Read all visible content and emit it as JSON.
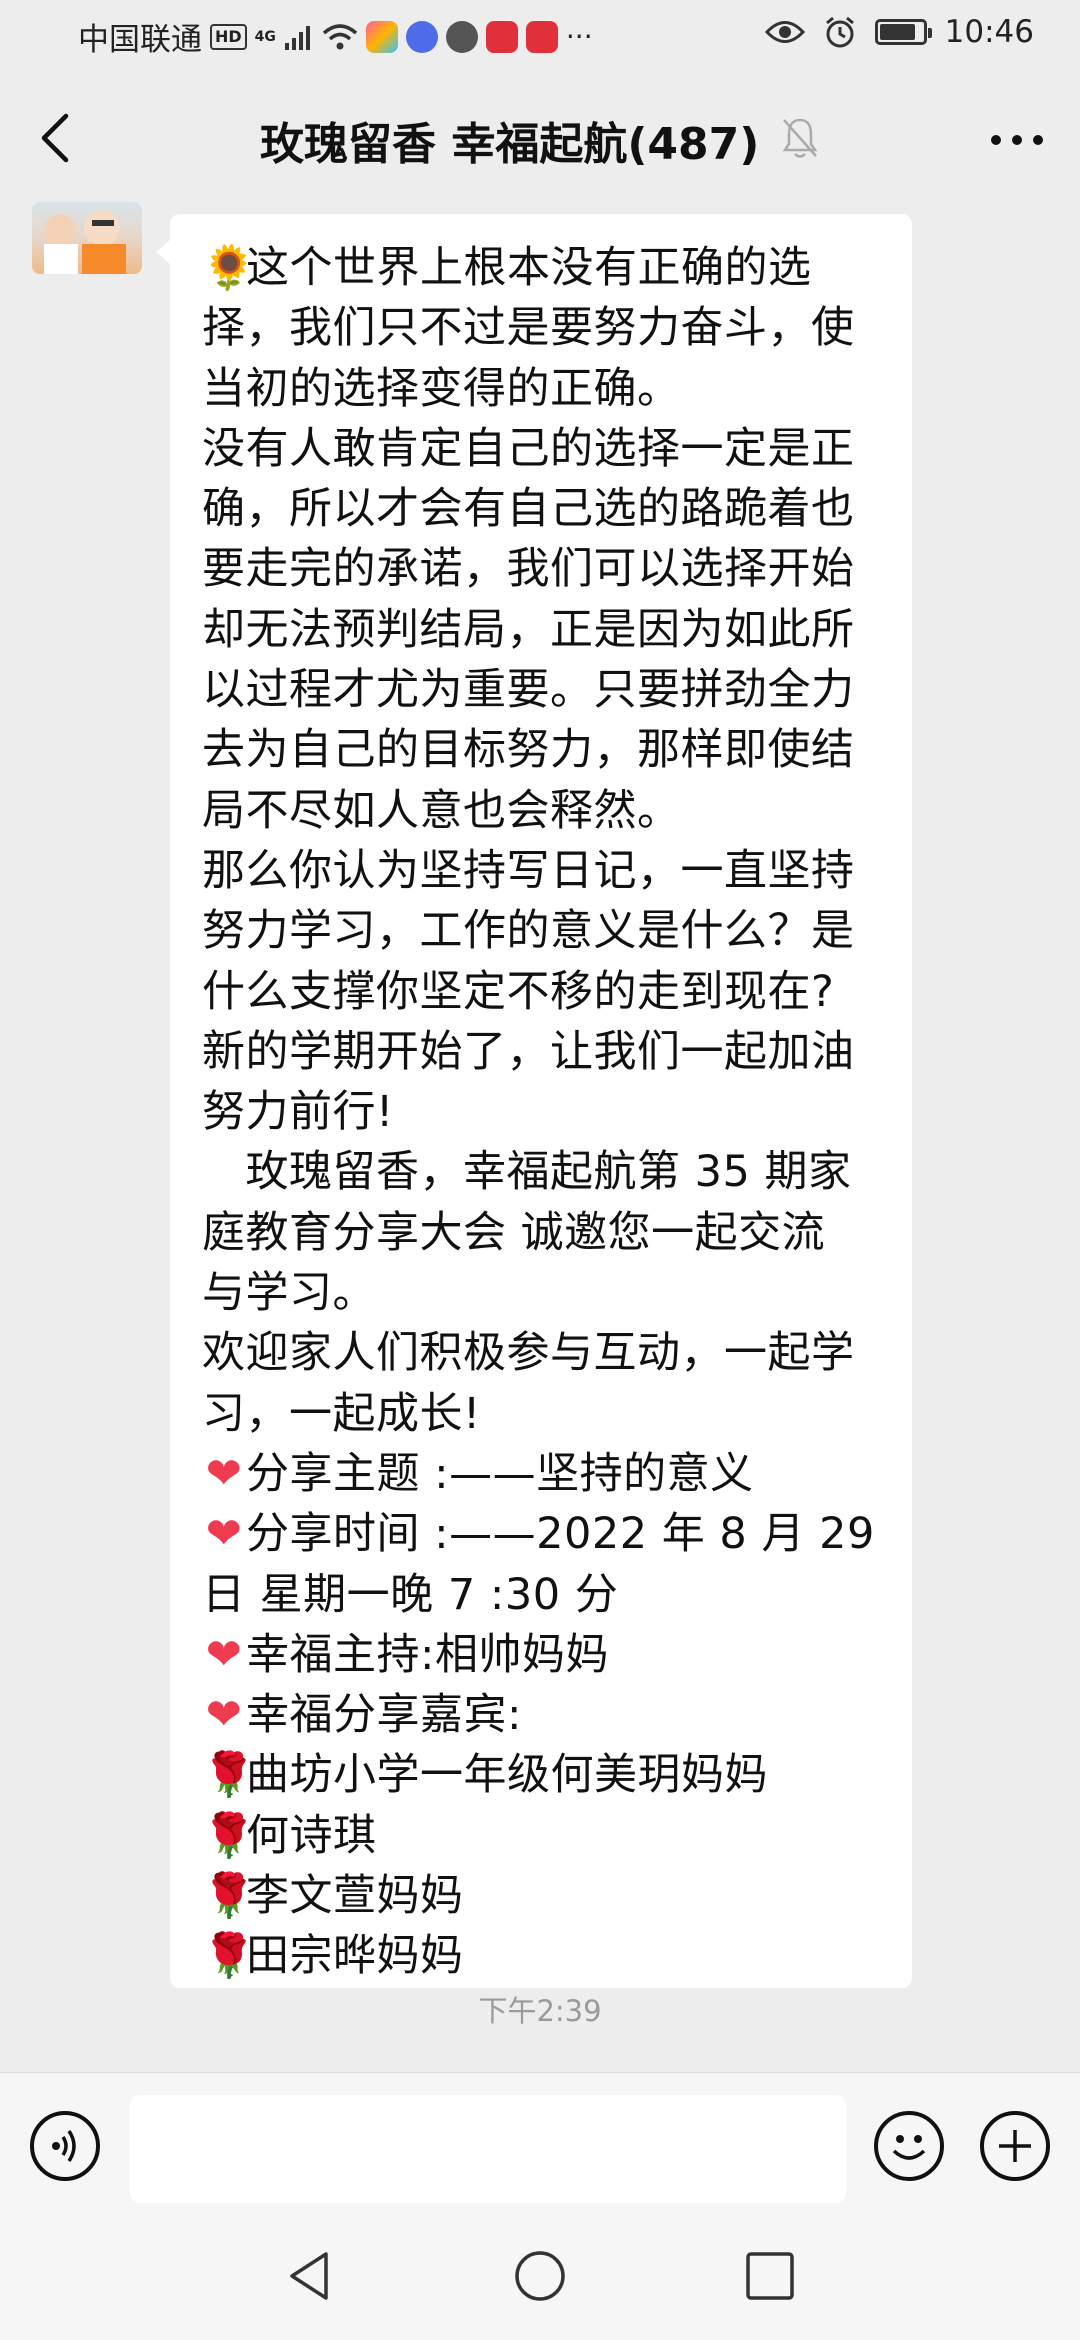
{
  "status_bar": {
    "carrier": "中国联通",
    "hd_badge": "HD",
    "network": "4G",
    "time": "10:46",
    "battery_level": 0.85
  },
  "header": {
    "title": "玫瑰留香  幸福起航(487)"
  },
  "message": {
    "lines": [
      "这个世界上根本没有正确的选",
      "择，我们只不过是要努力奋斗，使",
      "当初的选择变得的正确。",
      "没有人敢肯定自己的选择一定是正",
      "确，所以才会有自己选的路跪着也",
      "要走完的承诺，我们可以选择开始",
      "却无法预判结局，正是因为如此所",
      "以过程才尤为重要。只要拼劲全力",
      "去为自己的目标努力，那样即使结",
      "局不尽如人意也会释然。",
      "那么你认为坚持写日记，一直坚持",
      "努力学习，工作的意义是什么？是",
      "什么支撑你坚定不移的走到现在?",
      "新的学期开始了，让我们一起加油",
      "努力前行!",
      "　玫瑰留香，幸福起航第 35 期家",
      "庭教育分享大会 诚邀您一起交流",
      "与学习。",
      "欢迎家人们积极参与互动，一起学",
      "习，一起成长!",
      "分享主题 :——坚持的意义",
      "分享时间 :——2022 年 8 月 29",
      "日   星期一晚 7 :30 分",
      "幸福主持:相帅妈妈",
      "幸福分享嘉宾:",
      "曲坊小学一年级何美玥妈妈",
      "何诗琪",
      "李文萱妈妈",
      "田宗晔妈妈"
    ],
    "timestamp": "下午2:39"
  },
  "emojis": {
    "sun": "🌻",
    "heart": "❤",
    "rose": "🌹"
  },
  "icons": {
    "back": "chevron-left-icon",
    "mute": "bell-off-icon",
    "more": "more-dots-icon",
    "voice": "voice-icon",
    "emoji": "smiley-icon",
    "plus": "plus-icon"
  }
}
